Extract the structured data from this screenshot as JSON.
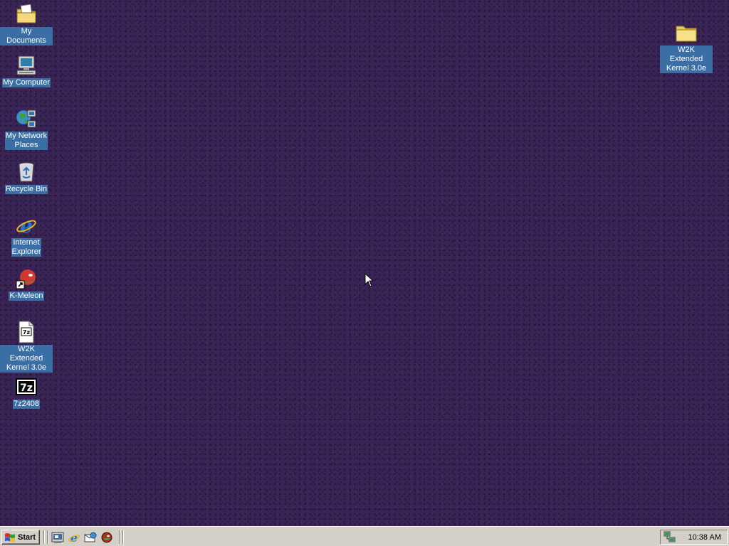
{
  "desktop": {
    "background_color": "#3a2456",
    "label_highlight_color": "#3a6ea5",
    "icons": [
      {
        "label": "My Documents",
        "icon": "my-documents-folder-icon"
      },
      {
        "label": "My Computer",
        "icon": "my-computer-icon"
      },
      {
        "label": "My Network\nPlaces",
        "icon": "network-places-icon"
      },
      {
        "label": "Recycle Bin",
        "icon": "recycle-bin-icon"
      },
      {
        "label": "Internet\nExplorer",
        "icon": "internet-explorer-icon"
      },
      {
        "label": "K-Meleon",
        "icon": "k-meleon-shortcut-icon"
      },
      {
        "label": "W2K Extended\nKernel 3.0e",
        "icon": "7z-archive-file-icon"
      },
      {
        "label": "7z2408",
        "icon": "7zip-installer-icon"
      },
      {
        "label": "W2K Extended\nKernel 3.0e",
        "icon": "folder-icon"
      }
    ]
  },
  "taskbar": {
    "start_label": "Start",
    "quick_launch": [
      {
        "icon": "show-desktop-icon"
      },
      {
        "icon": "internet-explorer-icon"
      },
      {
        "icon": "outlook-express-icon"
      },
      {
        "icon": "k-meleon-icon"
      }
    ],
    "tray": {
      "icons": [
        "network-connection-icon"
      ],
      "clock": "10:38 AM"
    }
  }
}
